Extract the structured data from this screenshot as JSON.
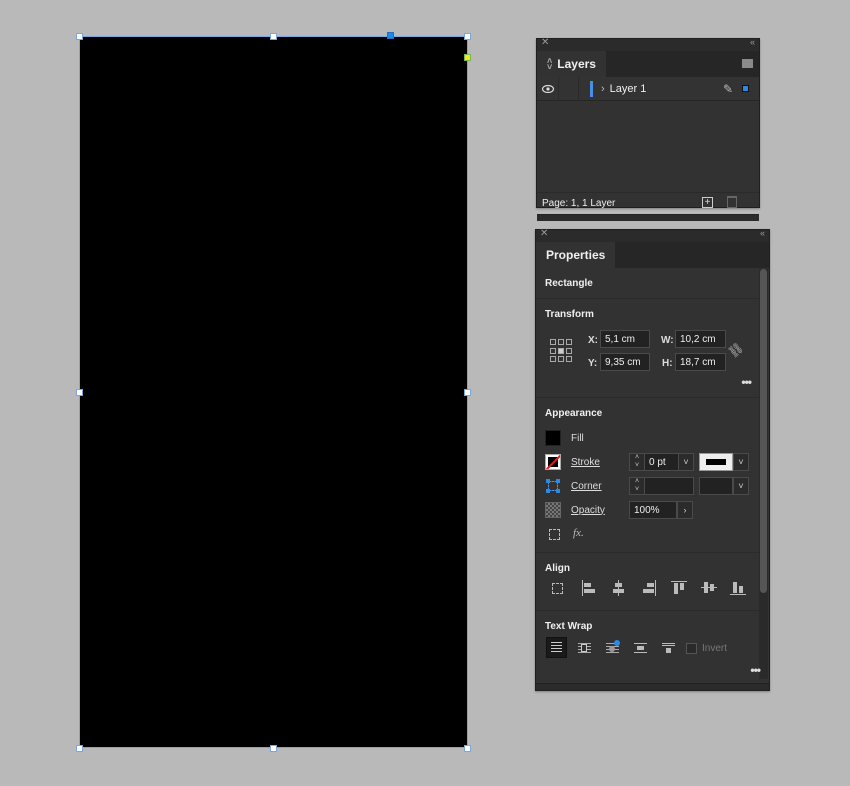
{
  "canvas": {
    "object_type": "rectangle",
    "fill_color": "#000000",
    "selection_color": "#7aa7e0"
  },
  "layers_panel": {
    "title": "Layers",
    "layers": [
      {
        "name": "Layer 1",
        "visible": true,
        "color": "#4a90e2",
        "expanded": false
      }
    ],
    "footer": "Page: 1, 1 Layer",
    "new_layer_icon": "+"
  },
  "properties_panel": {
    "title": "Properties",
    "object_type": "Rectangle",
    "transform": {
      "title": "Transform",
      "x_label": "X:",
      "x": "5,1 cm",
      "y_label": "Y:",
      "y": "9,35 cm",
      "w_label": "W:",
      "w": "10,2 cm",
      "h_label": "H:",
      "h": "18,7 cm",
      "more": "•••"
    },
    "appearance": {
      "title": "Appearance",
      "fill_label": "Fill",
      "stroke_label": "Stroke",
      "stroke_weight": "0 pt",
      "corner_label": "Corner",
      "corner_value": "",
      "opacity_label": "Opacity",
      "opacity": "100%",
      "fx": "fx."
    },
    "align": {
      "title": "Align"
    },
    "text_wrap": {
      "title": "Text Wrap",
      "invert_label": "Invert",
      "invert_checked": false,
      "more": "•••"
    }
  }
}
